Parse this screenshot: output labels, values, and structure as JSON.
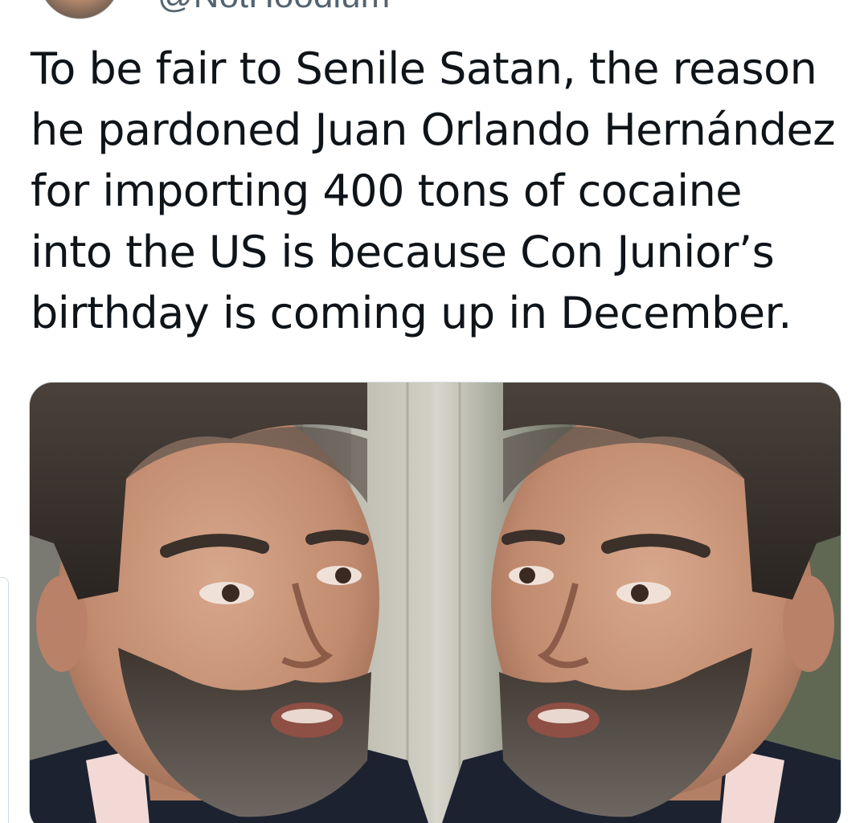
{
  "tweet": {
    "handle": "@NotHoodlum",
    "lines": [
      "To be fair to Senile Satan, the reason",
      "he pardoned Juan Orlando Hernández",
      "for importing 400 tons of cocaine",
      "into the US is because Con Junior’s",
      "birthday is coming up in December."
    ]
  },
  "media": {
    "description_icon": "photo-collage",
    "colors": {
      "skin": "#c9977c",
      "hair": "#3a3430",
      "beard": "#4a4039",
      "background_wall": "#d8d6cc",
      "suit": "#1c2230",
      "shirt": "#f2d9d6"
    }
  }
}
